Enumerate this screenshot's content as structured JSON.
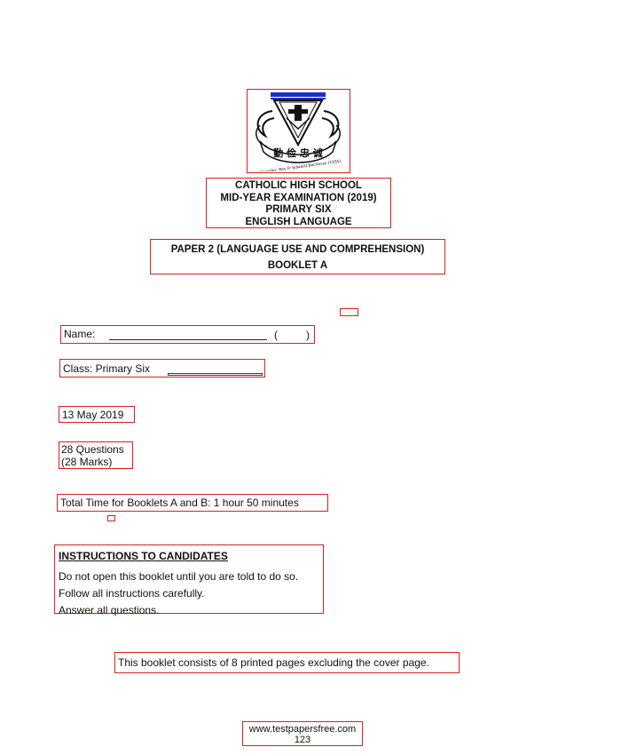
{
  "crest": {
    "motto_chars": "勤 俭 忠 诚",
    "founder_text": "Founder: Rev Fr Edward Becheras (1935)"
  },
  "header": {
    "school": "CATHOLIC HIGH SCHOOL",
    "exam": "MID-YEAR EXAMINATION (2019)",
    "level": "PRIMARY SIX",
    "subject": "ENGLISH LANGUAGE"
  },
  "paper": {
    "title": "PAPER 2 (LANGUAGE USE AND COMPREHENSION)",
    "booklet": "BOOKLET A"
  },
  "markers": {
    "small_mark": "·"
  },
  "fields": {
    "name_label": "Name:",
    "paren_open": "(",
    "paren_close": ")",
    "class_label": "Class: Primary Six"
  },
  "exam_info": {
    "date": "13 May 2019",
    "questions": "28 Questions",
    "marks": "(28 Marks)",
    "total_time": "Total Time for Booklets A and B: 1 hour 50 minutes"
  },
  "instructions": {
    "title": "INSTRUCTIONS TO CANDIDATES",
    "items": [
      "Do not open this booklet until you are told to do so.",
      "Follow all instructions carefully.",
      "Answer all questions."
    ]
  },
  "booklet_note": "This booklet consists of 8 printed pages excluding the cover page.",
  "footer": {
    "website": "www.testpapersfree.com",
    "page_number": "123"
  },
  "colors": {
    "annotation_border": "#d82020",
    "crest_blue": "#2030c0"
  }
}
